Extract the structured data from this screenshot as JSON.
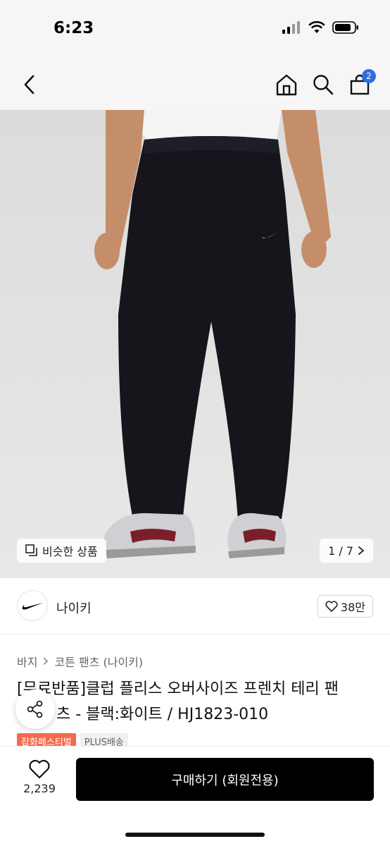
{
  "status_bar": {
    "time": "6:23"
  },
  "nav": {
    "cart_count": "2"
  },
  "image": {
    "similar_label": "비슷한 상품",
    "page_indicator": "1 / 7"
  },
  "brand": {
    "name": "나이키",
    "likes": "38만"
  },
  "breadcrumb": {
    "level1": "바지",
    "level2": "코튼 팬츠 (나이키)"
  },
  "product": {
    "title_line1": "[무료반품]클럽 플리스 오버사이즈 프렌치 테리 팬",
    "title_line2": "츠 - 블랙:화이트 / HJ1823-010",
    "tags": [
      "잡화페스티벌",
      "PLUS배송"
    ]
  },
  "bottom": {
    "wish_count": "2,239",
    "buy_label": "구매하기 (회원전용)"
  },
  "colors": {
    "accent": "#2f6de1",
    "festival_tag": "#f26b4f",
    "buy_button": "#000000"
  }
}
